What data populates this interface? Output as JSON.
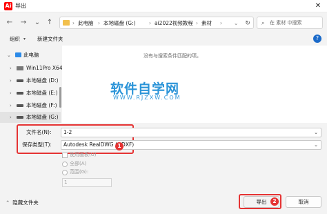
{
  "window": {
    "app_icon_text": "Ai",
    "title": "导出",
    "close_glyph": "✕"
  },
  "nav": {
    "back": "←",
    "forward": "→",
    "dropdown": "⌄",
    "up": "↑",
    "breadcrumb": [
      "此电脑",
      "本地磁盘 (G:)",
      "ai2022视频教程",
      "素材"
    ],
    "separator": "›",
    "refresh": "↻",
    "search_placeholder": "在 素材 中搜索",
    "search_icon": "⌕"
  },
  "toolbar": {
    "organize": "组织",
    "organize_caret": "▾",
    "new_folder": "新建文件夹",
    "help": "?"
  },
  "sidebar": {
    "items": [
      {
        "chevron": "⌄",
        "label": "此电脑",
        "icon": "pc-icon"
      },
      {
        "chevron": "›",
        "label": "Win11Pro X64",
        "icon": "drive-icon"
      },
      {
        "chevron": "›",
        "label": "本地磁盘 (D:)",
        "icon": "drive-icon"
      },
      {
        "chevron": "›",
        "label": "本地磁盘 (E:)",
        "icon": "drive-icon"
      },
      {
        "chevron": "›",
        "label": "本地磁盘 (F:)",
        "icon": "drive-icon"
      },
      {
        "chevron": "›",
        "label": "本地磁盘 (G:)",
        "icon": "drive-icon"
      }
    ]
  },
  "main": {
    "empty_message": "没有与搜索条件匹配的项。"
  },
  "watermark": {
    "title": "软件自学网",
    "url": "WWW.RJZXW.COM"
  },
  "form": {
    "filename_label": "文件名(N):",
    "filename_value": "1-2",
    "filetype_label": "保存类型(T):",
    "filetype_value": "Autodesk RealDWG (*.DXF)",
    "dropdown_arrow": "⌄",
    "badge_1": "1",
    "use_artboard_label": "使用画板(U)",
    "all_label": "全部(A)",
    "range_label": "范围(G):",
    "range_value": "1"
  },
  "footer": {
    "hide_folders": "隐藏文件夹",
    "hide_caret": "⌃",
    "export_label": "导出",
    "badge_2": "2",
    "cancel_label": "取消"
  },
  "colors": {
    "highlight": "#e53333",
    "watermark": "#2b94d8",
    "accent": "#1b6ac9"
  }
}
